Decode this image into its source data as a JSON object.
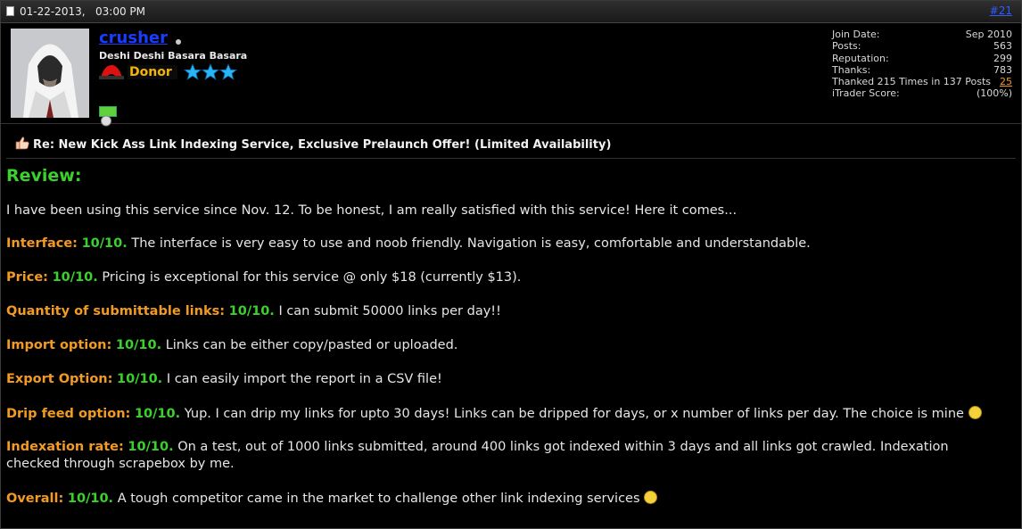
{
  "header": {
    "date": "01-22-2013,",
    "time": "03:00 PM",
    "post_number": "#21"
  },
  "user": {
    "name": "crusher",
    "title": "Deshi Deshi Basara Basara",
    "badge": "Donor",
    "stars": 3,
    "stats": [
      {
        "label": "Join Date:",
        "value": "Sep 2010"
      },
      {
        "label": "Posts:",
        "value": "563"
      },
      {
        "label": "Reputation:",
        "value": "299"
      },
      {
        "label": "Thanks:",
        "value": "783"
      }
    ],
    "thanked_text": "Thanked 215 Times in 137 Posts",
    "thanked_link": "25",
    "itrader_label": "iTrader Score:",
    "itrader_value": "(100%)"
  },
  "post": {
    "subject": "Re: New Kick Ass Link Indexing Service, Exclusive Prelaunch Offer! (Limited Availability)",
    "review_title": "Review:",
    "intro": "I have been using this service since Nov. 12. To be honest, I am really satisfied with this service! Here it comes...",
    "items": [
      {
        "label": "Interface:",
        "score": "10/10.",
        "text": "The interface is very easy to use and noob friendly. Navigation is easy, comfortable and understandable."
      },
      {
        "label": "Price:",
        "score": "10/10.",
        "text": "Pricing is exceptional for this service @ only $18 (currently $13)."
      },
      {
        "label": "Quantity of submittable links:",
        "score": "10/10.",
        "text": "I can submit 50000 links per day!!"
      },
      {
        "label": "Import option:",
        "score": "10/10.",
        "text": "Links can be either copy/pasted or uploaded."
      },
      {
        "label": "Export Option:",
        "score": "10/10.",
        "text": "I can easily import the report in a CSV file!"
      },
      {
        "label": "Drip feed option:",
        "score": "10/10.",
        "text": "Yup. I can drip my links for upto 30 days! Links can be dripped for days, or x number of links per day. The choice is mine"
      },
      {
        "label": "Indexation rate:",
        "score": "10/10.",
        "text": "On a test, out of 1000 links submitted, around 400 links got indexed within 3 days and all links got crawled. Indexation",
        "text2": "checked through scrapebox by me."
      },
      {
        "label": "Overall:",
        "score": "10/10.",
        "text": "A tough competitor came in the market to challenge other link indexing services"
      }
    ]
  },
  "colors": {
    "orange": "#f29a21",
    "green": "#3bd12d",
    "link_blue": "#1a3cff"
  }
}
